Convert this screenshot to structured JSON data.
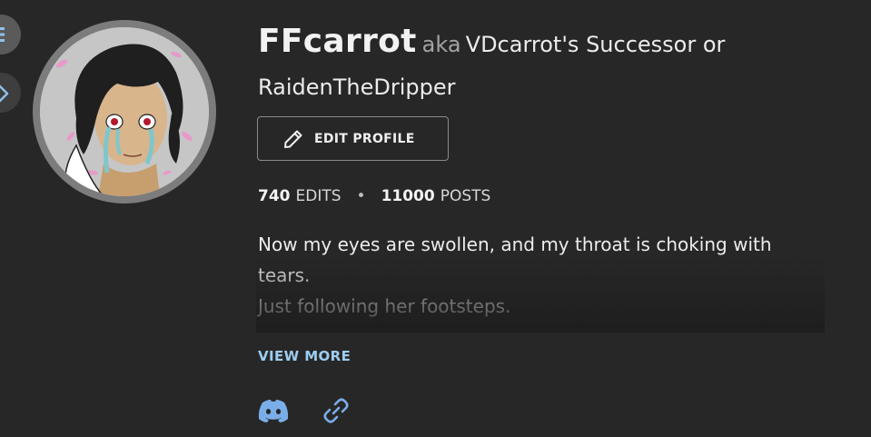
{
  "profile": {
    "username": "FFcarrot",
    "aka_label": "aka",
    "alias": "VDcarrot's Successor or RaidenTheDripper",
    "edit_label": "EDIT PROFILE",
    "stats": {
      "edits_count": "740",
      "edits_label": "EDITS",
      "separator": "•",
      "posts_count": "11000",
      "posts_label": "POSTS"
    },
    "bio_lines": [
      "Now my eyes are swollen, and my throat is choking with tears.",
      "Just following her footsteps."
    ],
    "view_more_label": "VIEW MORE"
  },
  "icons": {
    "menu": "menu-icon",
    "tag": "tag-icon",
    "edit": "pencil-icon",
    "discord": "discord-icon",
    "link": "link-icon"
  },
  "colors": {
    "background": "#272727",
    "accent": "#9ccdf0",
    "discord": "#7aaee8"
  }
}
